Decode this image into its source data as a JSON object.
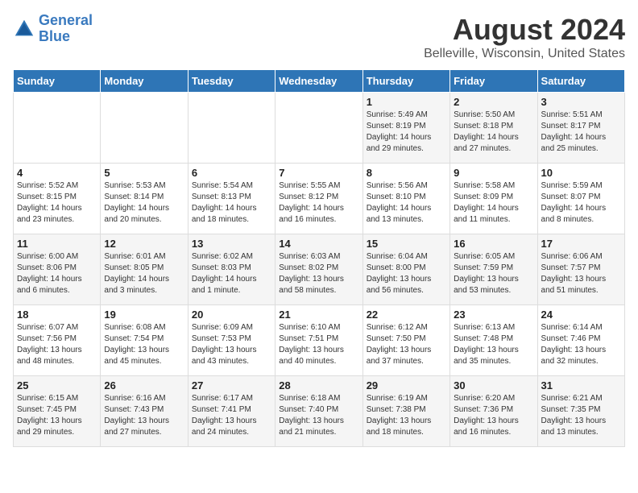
{
  "header": {
    "logo_line1": "General",
    "logo_line2": "Blue",
    "title": "August 2024",
    "subtitle": "Belleville, Wisconsin, United States"
  },
  "days_of_week": [
    "Sunday",
    "Monday",
    "Tuesday",
    "Wednesday",
    "Thursday",
    "Friday",
    "Saturday"
  ],
  "weeks": [
    [
      {
        "day": "",
        "info": ""
      },
      {
        "day": "",
        "info": ""
      },
      {
        "day": "",
        "info": ""
      },
      {
        "day": "",
        "info": ""
      },
      {
        "day": "1",
        "info": "Sunrise: 5:49 AM\nSunset: 8:19 PM\nDaylight: 14 hours\nand 29 minutes."
      },
      {
        "day": "2",
        "info": "Sunrise: 5:50 AM\nSunset: 8:18 PM\nDaylight: 14 hours\nand 27 minutes."
      },
      {
        "day": "3",
        "info": "Sunrise: 5:51 AM\nSunset: 8:17 PM\nDaylight: 14 hours\nand 25 minutes."
      }
    ],
    [
      {
        "day": "4",
        "info": "Sunrise: 5:52 AM\nSunset: 8:15 PM\nDaylight: 14 hours\nand 23 minutes."
      },
      {
        "day": "5",
        "info": "Sunrise: 5:53 AM\nSunset: 8:14 PM\nDaylight: 14 hours\nand 20 minutes."
      },
      {
        "day": "6",
        "info": "Sunrise: 5:54 AM\nSunset: 8:13 PM\nDaylight: 14 hours\nand 18 minutes."
      },
      {
        "day": "7",
        "info": "Sunrise: 5:55 AM\nSunset: 8:12 PM\nDaylight: 14 hours\nand 16 minutes."
      },
      {
        "day": "8",
        "info": "Sunrise: 5:56 AM\nSunset: 8:10 PM\nDaylight: 14 hours\nand 13 minutes."
      },
      {
        "day": "9",
        "info": "Sunrise: 5:58 AM\nSunset: 8:09 PM\nDaylight: 14 hours\nand 11 minutes."
      },
      {
        "day": "10",
        "info": "Sunrise: 5:59 AM\nSunset: 8:07 PM\nDaylight: 14 hours\nand 8 minutes."
      }
    ],
    [
      {
        "day": "11",
        "info": "Sunrise: 6:00 AM\nSunset: 8:06 PM\nDaylight: 14 hours\nand 6 minutes."
      },
      {
        "day": "12",
        "info": "Sunrise: 6:01 AM\nSunset: 8:05 PM\nDaylight: 14 hours\nand 3 minutes."
      },
      {
        "day": "13",
        "info": "Sunrise: 6:02 AM\nSunset: 8:03 PM\nDaylight: 14 hours\nand 1 minute."
      },
      {
        "day": "14",
        "info": "Sunrise: 6:03 AM\nSunset: 8:02 PM\nDaylight: 13 hours\nand 58 minutes."
      },
      {
        "day": "15",
        "info": "Sunrise: 6:04 AM\nSunset: 8:00 PM\nDaylight: 13 hours\nand 56 minutes."
      },
      {
        "day": "16",
        "info": "Sunrise: 6:05 AM\nSunset: 7:59 PM\nDaylight: 13 hours\nand 53 minutes."
      },
      {
        "day": "17",
        "info": "Sunrise: 6:06 AM\nSunset: 7:57 PM\nDaylight: 13 hours\nand 51 minutes."
      }
    ],
    [
      {
        "day": "18",
        "info": "Sunrise: 6:07 AM\nSunset: 7:56 PM\nDaylight: 13 hours\nand 48 minutes."
      },
      {
        "day": "19",
        "info": "Sunrise: 6:08 AM\nSunset: 7:54 PM\nDaylight: 13 hours\nand 45 minutes."
      },
      {
        "day": "20",
        "info": "Sunrise: 6:09 AM\nSunset: 7:53 PM\nDaylight: 13 hours\nand 43 minutes."
      },
      {
        "day": "21",
        "info": "Sunrise: 6:10 AM\nSunset: 7:51 PM\nDaylight: 13 hours\nand 40 minutes."
      },
      {
        "day": "22",
        "info": "Sunrise: 6:12 AM\nSunset: 7:50 PM\nDaylight: 13 hours\nand 37 minutes."
      },
      {
        "day": "23",
        "info": "Sunrise: 6:13 AM\nSunset: 7:48 PM\nDaylight: 13 hours\nand 35 minutes."
      },
      {
        "day": "24",
        "info": "Sunrise: 6:14 AM\nSunset: 7:46 PM\nDaylight: 13 hours\nand 32 minutes."
      }
    ],
    [
      {
        "day": "25",
        "info": "Sunrise: 6:15 AM\nSunset: 7:45 PM\nDaylight: 13 hours\nand 29 minutes."
      },
      {
        "day": "26",
        "info": "Sunrise: 6:16 AM\nSunset: 7:43 PM\nDaylight: 13 hours\nand 27 minutes."
      },
      {
        "day": "27",
        "info": "Sunrise: 6:17 AM\nSunset: 7:41 PM\nDaylight: 13 hours\nand 24 minutes."
      },
      {
        "day": "28",
        "info": "Sunrise: 6:18 AM\nSunset: 7:40 PM\nDaylight: 13 hours\nand 21 minutes."
      },
      {
        "day": "29",
        "info": "Sunrise: 6:19 AM\nSunset: 7:38 PM\nDaylight: 13 hours\nand 18 minutes."
      },
      {
        "day": "30",
        "info": "Sunrise: 6:20 AM\nSunset: 7:36 PM\nDaylight: 13 hours\nand 16 minutes."
      },
      {
        "day": "31",
        "info": "Sunrise: 6:21 AM\nSunset: 7:35 PM\nDaylight: 13 hours\nand 13 minutes."
      }
    ]
  ]
}
